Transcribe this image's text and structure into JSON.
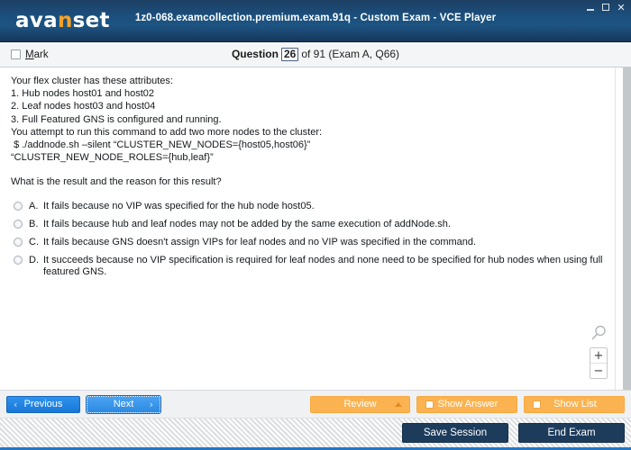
{
  "window": {
    "brand": {
      "text_before": "ava",
      "accent_letter": "n",
      "text_after": "set"
    },
    "title": "1z0-068.examcollection.premium.exam.91q - Custom Exam - VCE Player",
    "controls": {
      "minimize": "minimize-icon",
      "maximize": "maximize-icon",
      "close": "✕"
    },
    "colors": {
      "titlebar_blue": "#1b4f7d",
      "accent_orange": "#f3a32b",
      "button_blue": "#1877d6",
      "button_orange": "#fbb351",
      "button_dark": "#1d3c5c",
      "status_rule": "#2477c8"
    }
  },
  "question_header": {
    "mark_label_accel": "M",
    "mark_label_rest": "ark",
    "mark_checked": false,
    "counter": {
      "question_word": "Question",
      "current_number": "26",
      "rest": "of 91 (Exam A, Q66)"
    }
  },
  "question": {
    "body": "Your flex cluster has these attributes:\n1. Hub nodes host01 and host02\n2. Leaf nodes host03 and host04\n3. Full Featured GNS is configured and running.\nYou attempt to run this command to add two more nodes to the cluster:\n $ ./addnode.sh –silent “CLUSTER_NEW_NODES={host05,host06}”\n“CLUSTER_NEW_NODE_ROLES={hub,leaf}”",
    "prompt": "What is the result and the reason for this result?",
    "answers": [
      {
        "letter": "A.",
        "text": "It fails because no VIP was specified for the hub node host05.",
        "selected": false
      },
      {
        "letter": "B.",
        "text": "It fails because hub and leaf nodes may not be added by the same execution of addNode.sh.",
        "selected": false
      },
      {
        "letter": "C.",
        "text": "It fails because GNS doesn't assign VIPs for leaf nodes and no VIP was specified in the command.",
        "selected": false
      },
      {
        "letter": "D.",
        "text": "It succeeds because no VIP specification is required for leaf nodes and none need to be specified for hub nodes when using full featured GNS.",
        "selected": false
      }
    ]
  },
  "zoom_control": {
    "magnifier": "magnifier-icon",
    "zoom_in": "+",
    "zoom_out": "−"
  },
  "button_bar": {
    "previous": "Previous",
    "previous_arrow": "‹",
    "next": "Next",
    "next_arrow": "›",
    "review": "Review",
    "show_answer": "Show Answer",
    "show_list": "Show List"
  },
  "status_bar": {
    "save_session": "Save Session",
    "end_exam": "End Exam"
  }
}
